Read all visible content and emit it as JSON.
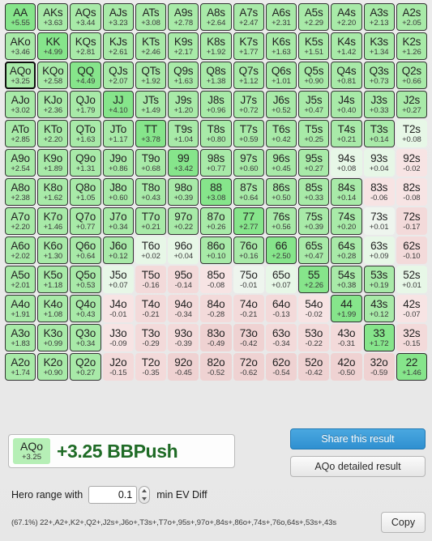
{
  "matrix": {
    "rows": [
      [
        {
          "hand": "AA",
          "ev": "+5.55",
          "tier": "t-pair"
        },
        {
          "hand": "AKs",
          "ev": "+3.63",
          "tier": "t-strong"
        },
        {
          "hand": "AQs",
          "ev": "+3.44",
          "tier": "t-strong"
        },
        {
          "hand": "AJs",
          "ev": "+3.23",
          "tier": "t-strong"
        },
        {
          "hand": "ATs",
          "ev": "+3.08",
          "tier": "t-strong"
        },
        {
          "hand": "A9s",
          "ev": "+2.78",
          "tier": "t-strong"
        },
        {
          "hand": "A8s",
          "ev": "+2.64",
          "tier": "t-strong"
        },
        {
          "hand": "A7s",
          "ev": "+2.47",
          "tier": "t-strong"
        },
        {
          "hand": "A6s",
          "ev": "+2.31",
          "tier": "t-strong"
        },
        {
          "hand": "A5s",
          "ev": "+2.29",
          "tier": "t-strong"
        },
        {
          "hand": "A4s",
          "ev": "+2.20",
          "tier": "t-strong"
        },
        {
          "hand": "A3s",
          "ev": "+2.13",
          "tier": "t-strong"
        },
        {
          "hand": "A2s",
          "ev": "+2.05",
          "tier": "t-strong"
        }
      ],
      [
        {
          "hand": "AKo",
          "ev": "+3.46",
          "tier": "t-strong"
        },
        {
          "hand": "KK",
          "ev": "+4.99",
          "tier": "t-pair"
        },
        {
          "hand": "KQs",
          "ev": "+2.81",
          "tier": "t-strong"
        },
        {
          "hand": "KJs",
          "ev": "+2.61",
          "tier": "t-strong"
        },
        {
          "hand": "KTs",
          "ev": "+2.46",
          "tier": "t-strong"
        },
        {
          "hand": "K9s",
          "ev": "+2.17",
          "tier": "t-strong"
        },
        {
          "hand": "K8s",
          "ev": "+1.92",
          "tier": "t-strong"
        },
        {
          "hand": "K7s",
          "ev": "+1.77",
          "tier": "t-strong"
        },
        {
          "hand": "K6s",
          "ev": "+1.63",
          "tier": "t-strong"
        },
        {
          "hand": "K5s",
          "ev": "+1.51",
          "tier": "t-strong"
        },
        {
          "hand": "K4s",
          "ev": "+1.42",
          "tier": "t-strong"
        },
        {
          "hand": "K3s",
          "ev": "+1.34",
          "tier": "t-strong"
        },
        {
          "hand": "K2s",
          "ev": "+1.26",
          "tier": "t-strong"
        }
      ],
      [
        {
          "hand": "AQo",
          "ev": "+3.25",
          "tier": "t-strong",
          "selected": true
        },
        {
          "hand": "KQo",
          "ev": "+2.58",
          "tier": "t-strong"
        },
        {
          "hand": "QQ",
          "ev": "+4.49",
          "tier": "t-pair"
        },
        {
          "hand": "QJs",
          "ev": "+2.07",
          "tier": "t-strong"
        },
        {
          "hand": "QTs",
          "ev": "+1.92",
          "tier": "t-strong"
        },
        {
          "hand": "Q9s",
          "ev": "+1.63",
          "tier": "t-strong"
        },
        {
          "hand": "Q8s",
          "ev": "+1.38",
          "tier": "t-strong"
        },
        {
          "hand": "Q7s",
          "ev": "+1.12",
          "tier": "t-strong"
        },
        {
          "hand": "Q6s",
          "ev": "+1.01",
          "tier": "t-strong"
        },
        {
          "hand": "Q5s",
          "ev": "+0.90",
          "tier": "t-strong"
        },
        {
          "hand": "Q4s",
          "ev": "+0.81",
          "tier": "t-strong"
        },
        {
          "hand": "Q3s",
          "ev": "+0.73",
          "tier": "t-strong"
        },
        {
          "hand": "Q2s",
          "ev": "+0.66",
          "tier": "t-strong"
        }
      ],
      [
        {
          "hand": "AJo",
          "ev": "+3.02",
          "tier": "t-strong"
        },
        {
          "hand": "KJo",
          "ev": "+2.36",
          "tier": "t-strong"
        },
        {
          "hand": "QJo",
          "ev": "+1.79",
          "tier": "t-strong"
        },
        {
          "hand": "JJ",
          "ev": "+4.10",
          "tier": "t-pair"
        },
        {
          "hand": "JTs",
          "ev": "+1.49",
          "tier": "t-strong"
        },
        {
          "hand": "J9s",
          "ev": "+1.20",
          "tier": "t-strong"
        },
        {
          "hand": "J8s",
          "ev": "+0.96",
          "tier": "t-strong"
        },
        {
          "hand": "J7s",
          "ev": "+0.72",
          "tier": "t-strong"
        },
        {
          "hand": "J6s",
          "ev": "+0.52",
          "tier": "t-strong"
        },
        {
          "hand": "J5s",
          "ev": "+0.47",
          "tier": "t-strong"
        },
        {
          "hand": "J4s",
          "ev": "+0.40",
          "tier": "t-strong"
        },
        {
          "hand": "J3s",
          "ev": "+0.33",
          "tier": "t-strong"
        },
        {
          "hand": "J2s",
          "ev": "+0.27",
          "tier": "t-strong"
        }
      ],
      [
        {
          "hand": "ATo",
          "ev": "+2.85",
          "tier": "t-strong"
        },
        {
          "hand": "KTo",
          "ev": "+2.20",
          "tier": "t-strong"
        },
        {
          "hand": "QTo",
          "ev": "+1.63",
          "tier": "t-strong"
        },
        {
          "hand": "JTo",
          "ev": "+1.17",
          "tier": "t-strong"
        },
        {
          "hand": "TT",
          "ev": "+3.78",
          "tier": "t-pair"
        },
        {
          "hand": "T9s",
          "ev": "+1.04",
          "tier": "t-strong"
        },
        {
          "hand": "T8s",
          "ev": "+0.80",
          "tier": "t-strong"
        },
        {
          "hand": "T7s",
          "ev": "+0.59",
          "tier": "t-strong"
        },
        {
          "hand": "T6s",
          "ev": "+0.42",
          "tier": "t-strong"
        },
        {
          "hand": "T5s",
          "ev": "+0.25",
          "tier": "t-strong"
        },
        {
          "hand": "T4s",
          "ev": "+0.21",
          "tier": "t-strong"
        },
        {
          "hand": "T3s",
          "ev": "+0.14",
          "tier": "t-strong"
        },
        {
          "hand": "T2s",
          "ev": "+0.08",
          "tier": "t-pale"
        }
      ],
      [
        {
          "hand": "A9o",
          "ev": "+2.54",
          "tier": "t-strong"
        },
        {
          "hand": "K9o",
          "ev": "+1.89",
          "tier": "t-strong"
        },
        {
          "hand": "Q9o",
          "ev": "+1.31",
          "tier": "t-strong"
        },
        {
          "hand": "J9o",
          "ev": "+0.86",
          "tier": "t-strong"
        },
        {
          "hand": "T9o",
          "ev": "+0.68",
          "tier": "t-strong"
        },
        {
          "hand": "99",
          "ev": "+3.42",
          "tier": "t-pair"
        },
        {
          "hand": "98s",
          "ev": "+0.77",
          "tier": "t-strong"
        },
        {
          "hand": "97s",
          "ev": "+0.60",
          "tier": "t-strong"
        },
        {
          "hand": "96s",
          "ev": "+0.45",
          "tier": "t-strong"
        },
        {
          "hand": "95s",
          "ev": "+0.27",
          "tier": "t-strong"
        },
        {
          "hand": "94s",
          "ev": "+0.08",
          "tier": "t-pale"
        },
        {
          "hand": "93s",
          "ev": "+0.04",
          "tier": "t-pale"
        },
        {
          "hand": "92s",
          "ev": "-0.02",
          "tier": "t-neg1"
        }
      ],
      [
        {
          "hand": "A8o",
          "ev": "+2.38",
          "tier": "t-strong"
        },
        {
          "hand": "K8o",
          "ev": "+1.62",
          "tier": "t-strong"
        },
        {
          "hand": "Q8o",
          "ev": "+1.05",
          "tier": "t-strong"
        },
        {
          "hand": "J8o",
          "ev": "+0.60",
          "tier": "t-strong"
        },
        {
          "hand": "T8o",
          "ev": "+0.43",
          "tier": "t-strong"
        },
        {
          "hand": "98o",
          "ev": "+0.39",
          "tier": "t-strong"
        },
        {
          "hand": "88",
          "ev": "+3.08",
          "tier": "t-pair"
        },
        {
          "hand": "87s",
          "ev": "+0.64",
          "tier": "t-strong"
        },
        {
          "hand": "86s",
          "ev": "+0.50",
          "tier": "t-strong"
        },
        {
          "hand": "85s",
          "ev": "+0.33",
          "tier": "t-strong"
        },
        {
          "hand": "84s",
          "ev": "+0.14",
          "tier": "t-strong"
        },
        {
          "hand": "83s",
          "ev": "-0.06",
          "tier": "t-neg1"
        },
        {
          "hand": "82s",
          "ev": "-0.08",
          "tier": "t-neg1"
        }
      ],
      [
        {
          "hand": "A7o",
          "ev": "+2.20",
          "tier": "t-strong"
        },
        {
          "hand": "K7o",
          "ev": "+1.46",
          "tier": "t-strong"
        },
        {
          "hand": "Q7o",
          "ev": "+0.77",
          "tier": "t-strong"
        },
        {
          "hand": "J7o",
          "ev": "+0.34",
          "tier": "t-strong"
        },
        {
          "hand": "T7o",
          "ev": "+0.21",
          "tier": "t-strong"
        },
        {
          "hand": "97o",
          "ev": "+0.22",
          "tier": "t-strong"
        },
        {
          "hand": "87o",
          "ev": "+0.26",
          "tier": "t-strong"
        },
        {
          "hand": "77",
          "ev": "+2.77",
          "tier": "t-pair"
        },
        {
          "hand": "76s",
          "ev": "+0.56",
          "tier": "t-strong"
        },
        {
          "hand": "75s",
          "ev": "+0.39",
          "tier": "t-strong"
        },
        {
          "hand": "74s",
          "ev": "+0.20",
          "tier": "t-strong"
        },
        {
          "hand": "73s",
          "ev": "+0.01",
          "tier": "t-neutral"
        },
        {
          "hand": "72s",
          "ev": "-0.17",
          "tier": "t-neg2"
        }
      ],
      [
        {
          "hand": "A6o",
          "ev": "+2.02",
          "tier": "t-strong"
        },
        {
          "hand": "K6o",
          "ev": "+1.30",
          "tier": "t-strong"
        },
        {
          "hand": "Q6o",
          "ev": "+0.64",
          "tier": "t-strong"
        },
        {
          "hand": "J6o",
          "ev": "+0.12",
          "tier": "t-strong"
        },
        {
          "hand": "T6o",
          "ev": "+0.02",
          "tier": "t-pale"
        },
        {
          "hand": "96o",
          "ev": "+0.04",
          "tier": "t-pale"
        },
        {
          "hand": "86o",
          "ev": "+0.10",
          "tier": "t-strong"
        },
        {
          "hand": "76o",
          "ev": "+0.16",
          "tier": "t-strong"
        },
        {
          "hand": "66",
          "ev": "+2.50",
          "tier": "t-pair"
        },
        {
          "hand": "65s",
          "ev": "+0.47",
          "tier": "t-strong"
        },
        {
          "hand": "64s",
          "ev": "+0.28",
          "tier": "t-strong"
        },
        {
          "hand": "63s",
          "ev": "+0.09",
          "tier": "t-pale"
        },
        {
          "hand": "62s",
          "ev": "-0.10",
          "tier": "t-neg2"
        }
      ],
      [
        {
          "hand": "A5o",
          "ev": "+2.01",
          "tier": "t-strong"
        },
        {
          "hand": "K5o",
          "ev": "+1.18",
          "tier": "t-strong"
        },
        {
          "hand": "Q5o",
          "ev": "+0.53",
          "tier": "t-strong"
        },
        {
          "hand": "J5o",
          "ev": "+0.07",
          "tier": "t-pale"
        },
        {
          "hand": "T5o",
          "ev": "-0.16",
          "tier": "t-neg2"
        },
        {
          "hand": "95o",
          "ev": "-0.14",
          "tier": "t-neg2"
        },
        {
          "hand": "85o",
          "ev": "-0.08",
          "tier": "t-neg1"
        },
        {
          "hand": "75o",
          "ev": "-0.01",
          "tier": "t-neutral"
        },
        {
          "hand": "65o",
          "ev": "+0.07",
          "tier": "t-pale"
        },
        {
          "hand": "55",
          "ev": "+2.26",
          "tier": "t-pair"
        },
        {
          "hand": "54s",
          "ev": "+0.38",
          "tier": "t-strong"
        },
        {
          "hand": "53s",
          "ev": "+0.19",
          "tier": "t-strong"
        },
        {
          "hand": "52s",
          "ev": "+0.01",
          "tier": "t-pale"
        }
      ],
      [
        {
          "hand": "A4o",
          "ev": "+1.91",
          "tier": "t-strong"
        },
        {
          "hand": "K4o",
          "ev": "+1.08",
          "tier": "t-strong"
        },
        {
          "hand": "Q4o",
          "ev": "+0.43",
          "tier": "t-strong"
        },
        {
          "hand": "J4o",
          "ev": "-0.01",
          "tier": "t-neg1"
        },
        {
          "hand": "T4o",
          "ev": "-0.21",
          "tier": "t-neg2"
        },
        {
          "hand": "94o",
          "ev": "-0.34",
          "tier": "t-neg2"
        },
        {
          "hand": "84o",
          "ev": "-0.28",
          "tier": "t-neg2"
        },
        {
          "hand": "74o",
          "ev": "-0.21",
          "tier": "t-neg2"
        },
        {
          "hand": "64o",
          "ev": "-0.13",
          "tier": "t-neg2"
        },
        {
          "hand": "54o",
          "ev": "-0.02",
          "tier": "t-neg1"
        },
        {
          "hand": "44",
          "ev": "+1.99",
          "tier": "t-pair"
        },
        {
          "hand": "43s",
          "ev": "+0.12",
          "tier": "t-strong"
        },
        {
          "hand": "42s",
          "ev": "-0.07",
          "tier": "t-neg1"
        }
      ],
      [
        {
          "hand": "A3o",
          "ev": "+1.83",
          "tier": "t-strong"
        },
        {
          "hand": "K3o",
          "ev": "+0.99",
          "tier": "t-strong"
        },
        {
          "hand": "Q3o",
          "ev": "+0.34",
          "tier": "t-strong"
        },
        {
          "hand": "J3o",
          "ev": "-0.09",
          "tier": "t-neg1"
        },
        {
          "hand": "T3o",
          "ev": "-0.29",
          "tier": "t-neg2"
        },
        {
          "hand": "93o",
          "ev": "-0.39",
          "tier": "t-neg2"
        },
        {
          "hand": "83o",
          "ev": "-0.49",
          "tier": "t-neg3"
        },
        {
          "hand": "73o",
          "ev": "-0.42",
          "tier": "t-neg3"
        },
        {
          "hand": "63o",
          "ev": "-0.34",
          "tier": "t-neg2"
        },
        {
          "hand": "53o",
          "ev": "-0.22",
          "tier": "t-neg2"
        },
        {
          "hand": "43o",
          "ev": "-0.31",
          "tier": "t-neg2"
        },
        {
          "hand": "33",
          "ev": "+1.72",
          "tier": "t-pair"
        },
        {
          "hand": "32s",
          "ev": "-0.15",
          "tier": "t-neg2"
        }
      ],
      [
        {
          "hand": "A2o",
          "ev": "+1.74",
          "tier": "t-strong"
        },
        {
          "hand": "K2o",
          "ev": "+0.90",
          "tier": "t-strong"
        },
        {
          "hand": "Q2o",
          "ev": "+0.27",
          "tier": "t-strong"
        },
        {
          "hand": "J2o",
          "ev": "-0.15",
          "tier": "t-neg2"
        },
        {
          "hand": "T2o",
          "ev": "-0.35",
          "tier": "t-neg2"
        },
        {
          "hand": "92o",
          "ev": "-0.45",
          "tier": "t-neg3"
        },
        {
          "hand": "82o",
          "ev": "-0.52",
          "tier": "t-neg3"
        },
        {
          "hand": "72o",
          "ev": "-0.62",
          "tier": "t-neg3"
        },
        {
          "hand": "62o",
          "ev": "-0.54",
          "tier": "t-neg3"
        },
        {
          "hand": "52o",
          "ev": "-0.42",
          "tier": "t-neg3"
        },
        {
          "hand": "42o",
          "ev": "-0.50",
          "tier": "t-neg3"
        },
        {
          "hand": "32o",
          "ev": "-0.59",
          "tier": "t-neg3"
        },
        {
          "hand": "22",
          "ev": "+1.46",
          "tier": "t-pair"
        }
      ]
    ]
  },
  "result": {
    "chip_hand": "AQo",
    "chip_ev": "+3.25",
    "text": "+3.25 BBPush"
  },
  "actions": {
    "share_label": "Share this result",
    "detail_label": "AQo detailed result",
    "copy_label": "Copy"
  },
  "hero_range": {
    "label": "Hero range with",
    "value": "0.1",
    "suffix": "min EV Diff"
  },
  "range_string": "(67.1%) 22+,A2+,K2+,Q2+,J2s+,J6o+,T3s+,T7o+,95s+,97o+,84s+,86o+,74s+,76o,64s+,53s+,43s"
}
